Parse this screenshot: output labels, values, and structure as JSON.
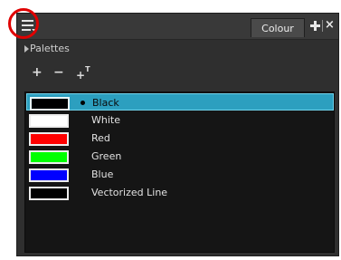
{
  "panel": {
    "tab_label": "Colour",
    "tab_add_label": "+",
    "tab_close_label": "×",
    "palettes_label": "Palettes",
    "tools": {
      "add_label": "+",
      "remove_label": "−",
      "rename_label": "+",
      "rename_sup": "T"
    }
  },
  "swatches": [
    {
      "name": "Black",
      "color": "#000000",
      "selected": true
    },
    {
      "name": "White",
      "color": "#ffffff",
      "selected": false
    },
    {
      "name": "Red",
      "color": "#ff0000",
      "selected": false
    },
    {
      "name": "Green",
      "color": "#00ff00",
      "selected": false
    },
    {
      "name": "Blue",
      "color": "#0000ff",
      "selected": false
    },
    {
      "name": "Vectorized Line",
      "color": "#000000",
      "selected": false
    }
  ],
  "colors": {
    "highlight": "#e00000",
    "selection": "#2c9fbf"
  }
}
